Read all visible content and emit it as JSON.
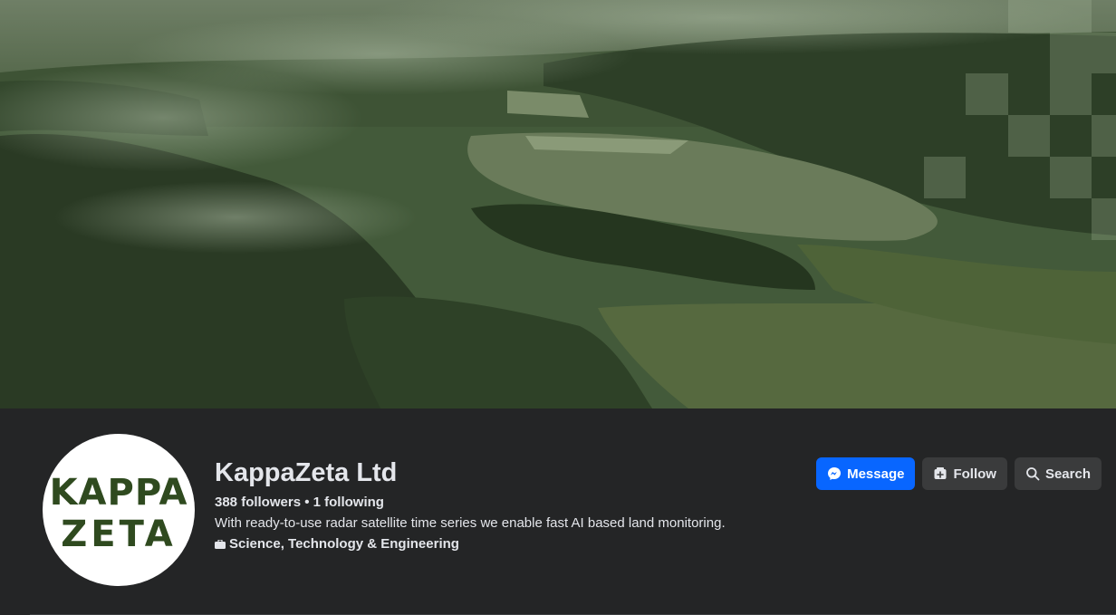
{
  "page": {
    "name": "KappaZeta Ltd",
    "followers_text": "388 followers",
    "separator": " • ",
    "following_text": "1 following",
    "bio": "With ready-to-use radar satellite time series we enable fast AI based land monitoring.",
    "category": "Science, Technology & Engineering",
    "category_icon": "briefcase-icon"
  },
  "logo": {
    "line1": "KAPPA",
    "line2": "ZETA",
    "color": "#2f4a1f"
  },
  "actions": {
    "message_label": "Message",
    "message_icon": "messenger-icon",
    "follow_label": "Follow",
    "follow_icon": "follow-page-icon",
    "search_label": "Search",
    "search_icon": "search-icon"
  },
  "colors": {
    "background": "#242526",
    "primary_button": "#0866ff",
    "secondary_button": "#3a3b3c",
    "text": "#e4e6eb"
  }
}
